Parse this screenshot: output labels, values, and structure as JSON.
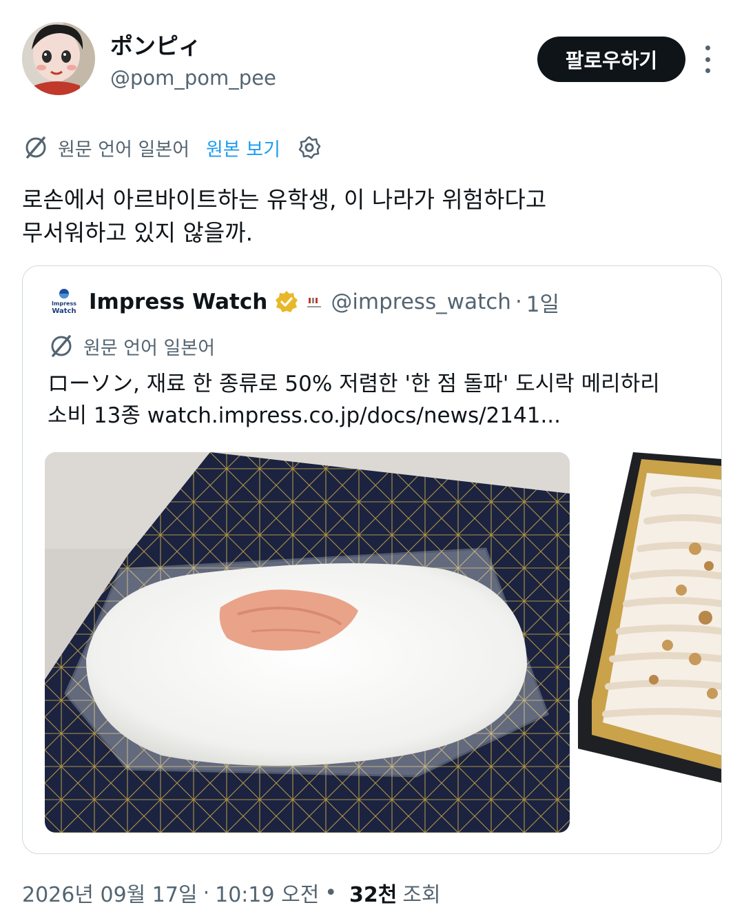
{
  "author": {
    "display_name": "ポンピィ",
    "handle": "@pom_pom_pee",
    "follow_label": "팔로우하기"
  },
  "translation": {
    "source_language": "원문 언어 일본어",
    "show_original": "원본 보기"
  },
  "tweet": {
    "line1": "로손에서 아르바이트하는 유학생, 이 나라가 위험하다고",
    "line2": "무서워하고 있지 않을까."
  },
  "quote": {
    "logo_line1": "Impress",
    "logo_line2": "Watch",
    "name": "Impress Watch",
    "affiliate_label": "Impress",
    "handle": "@impress_watch",
    "separator": "·",
    "time": "1일",
    "source_language": "원문 언어 일본어",
    "line1": "ローソン, 재료 한 종류로 50% 저렴한 '한 점 돌파' 도시락 메리하리",
    "line2": "소비 13종 watch.impress.co.jp/docs/news/2141..."
  },
  "footer": {
    "date": "2026년 09월 17일",
    "dot1": "·",
    "time": "10:19 오전",
    "dot2": "•",
    "views_count": "32천",
    "views_label": "조회"
  },
  "colors": {
    "text_primary": "#0f1419",
    "text_secondary": "#536471",
    "link": "#1d9bf0",
    "border": "#cfd9de",
    "verified_gold": "#e8b82a"
  },
  "icons": {
    "translate": "translate-icon",
    "settings": "gear-icon",
    "more": "more-vertical-icon",
    "verified": "verified-badge-icon"
  }
}
